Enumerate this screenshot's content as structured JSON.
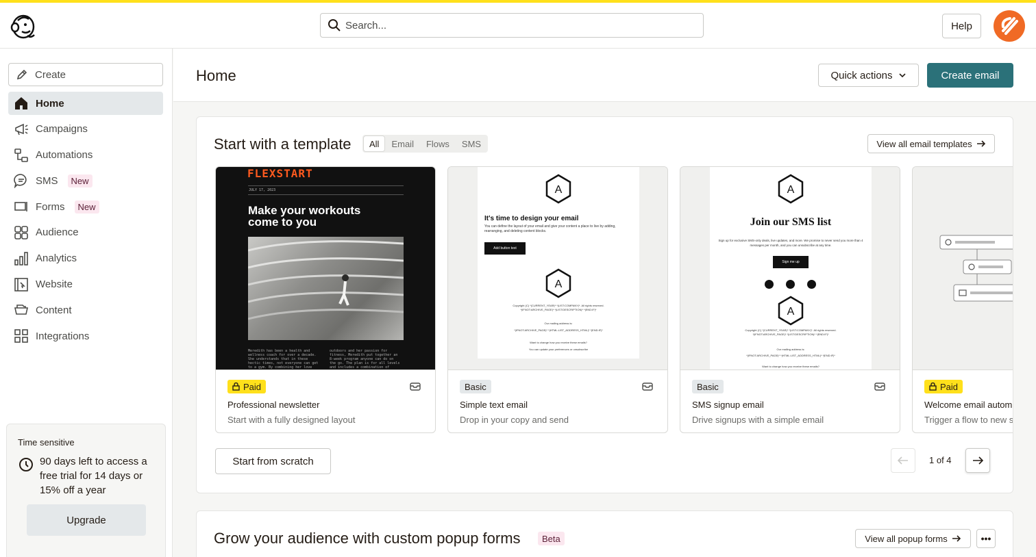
{
  "topbar": {
    "search_placeholder": "Search...",
    "help_label": "Help"
  },
  "sidebar": {
    "create_label": "Create",
    "items": [
      {
        "label": "Home",
        "active": true
      },
      {
        "label": "Campaigns"
      },
      {
        "label": "Automations"
      },
      {
        "label": "SMS",
        "badge": "New"
      },
      {
        "label": "Forms",
        "badge": "New"
      },
      {
        "label": "Audience"
      },
      {
        "label": "Analytics"
      },
      {
        "label": "Website"
      },
      {
        "label": "Content"
      },
      {
        "label": "Integrations"
      }
    ],
    "trial": {
      "label": "Time sensitive",
      "text": "90 days left to access a free trial for 14 days or 15% off a year",
      "upgrade_label": "Upgrade"
    }
  },
  "header": {
    "title": "Home",
    "quick_actions_label": "Quick actions",
    "create_email_label": "Create email"
  },
  "templates": {
    "title": "Start with a template",
    "tabs": [
      {
        "label": "All",
        "active": true
      },
      {
        "label": "Email"
      },
      {
        "label": "Flows"
      },
      {
        "label": "SMS"
      }
    ],
    "view_all_label": "View all email templates",
    "cards": [
      {
        "badge": "Paid",
        "title": "Professional newsletter",
        "description": "Start with a fully designed layout"
      },
      {
        "badge": "Basic",
        "title": "Simple text email",
        "description": "Drop in your copy and send"
      },
      {
        "badge": "Basic",
        "title": "SMS signup email",
        "description": "Drive signups with a simple email"
      },
      {
        "badge": "Paid",
        "title": "Welcome email autom",
        "description": "Trigger a flow to new s"
      }
    ],
    "preview_newsletter": {
      "brand": "FLEXSTART",
      "date": "JULY 17, 2023",
      "headline": "Make your workouts come to you",
      "col1": "Meredith has been a health and wellness coach for over a decade. She understands that in these hectic times, not everyone can get to a gym. By combining her love for",
      "col2": "outdoors and her passion for fitness, Meredith put together an 8-week program anyone can do on the go. The plan is for all levels and includes a combination of cardio,"
    },
    "preview_simple": {
      "logo_letter": "A",
      "heading": "It's time to design your email",
      "body": "You can define the layout of your email and give your content a place to live by adding, rearranging, and deleting content blocks.",
      "button": "Add button text",
      "footer": "Copyright (C) *|CURRENT_YEAR|* *|LIST:COMPANY|*. All rights reserved. *|IFNOT:ARCHIVE_PAGE|* *|LIST:DESCRIPTION|* *|END:IF|*",
      "mailing": "Our mailing address is:",
      "address": "*|IFNOT:ARCHIVE_PAGE|* *|HTML:LIST_ADDRESS_HTML|* *|END:IF|*",
      "change": "Want to change how you receive these emails?",
      "update": "You can update your preferences or unsubscribe"
    },
    "preview_sms": {
      "logo_letter": "A",
      "heading": "Join our SMS list",
      "body": "Sign up for exclusive SMS-only deals, live updates, and more. We promise to never send you more than 4 messages per month, and you can unsubscribe at any time.",
      "button": "Sign me up",
      "footer": "Copyright (C) *|CURRENT_YEAR|* *|LIST:COMPANY|*. All rights reserved. *|IFNOT:ARCHIVE_PAGE|* *|LIST:DESCRIPTION|* *|END:IF|*",
      "mailing": "Our mailing address is:",
      "address": "*|IFNOT:ARCHIVE_PAGE|* *|HTML:LIST_ADDRESS_HTML|* *|END:IF|*",
      "change": "Want to change how you receive these emails?"
    },
    "scratch_label": "Start from scratch",
    "pager_text": "1 of 4"
  },
  "popup_forms": {
    "title": "Grow your audience with custom popup forms",
    "badge": "Beta",
    "view_all_label": "View all popup forms",
    "more_label": "•••"
  },
  "colors": {
    "accent_yellow": "#ffe01b",
    "primary_teal": "#2b7179",
    "avatar_orange": "#f06a25",
    "new_badge_bg": "#fbe7ef"
  }
}
